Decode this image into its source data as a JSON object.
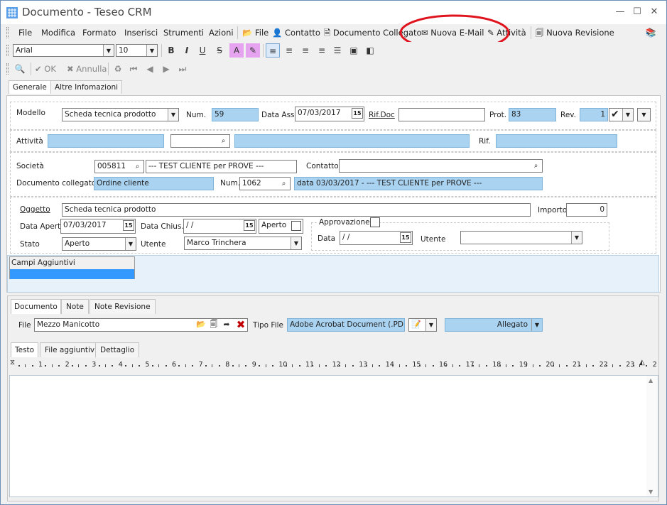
{
  "window": {
    "title": "Documento - Teseo CRM"
  },
  "menu": {
    "file": "File",
    "modifica": "Modifica",
    "formato": "Formato",
    "inserisci": "Inserisci",
    "strumenti": "Strumenti",
    "azioni": "Azioni"
  },
  "actions": {
    "file": "File",
    "contatto": "Contatto",
    "documento_collegato": "Documento Collegato",
    "nuova_email": "Nuova E-Mail",
    "attivita": "Attività",
    "nuova_revisione": "Nuova Revisione"
  },
  "format": {
    "font": "Arial",
    "size": "10"
  },
  "nav": {
    "ok": "OK",
    "annulla": "Annulla"
  },
  "tabs_main": [
    "Generale",
    "Altre Infomazioni"
  ],
  "modello": {
    "label": "Modello",
    "value": "Scheda tecnica prodotto",
    "num_label": "Num.",
    "num": "59",
    "data_ass_label": "Data Ass.",
    "data_ass": "07/03/2017",
    "rifdoc_label": "Rif.Doc",
    "rifdoc": "",
    "prot_label": "Prot.",
    "prot": "83",
    "rev_label": "Rev.",
    "rev": "1"
  },
  "attivita": {
    "label": "Attività",
    "rif_label": "Rif."
  },
  "societa": {
    "label": "Società",
    "code": "005811",
    "name": "--- TEST CLIENTE per PROVE ---",
    "contatto_label": "Contatto",
    "contatto": ""
  },
  "doc_collegato": {
    "label": "Documento collegato",
    "value": "Ordine cliente",
    "num_label": "Num.",
    "num": "1062",
    "desc": "data 03/03/2017 - --- TEST CLIENTE per PROVE ---"
  },
  "oggetto": {
    "label": "Oggetto",
    "value": "Scheda tecnica prodotto",
    "importo_label": "Importo",
    "importo": "0"
  },
  "date": {
    "apert_label": "Data Apert.",
    "apert": "07/03/2017",
    "chius_label": "Data Chius.",
    "chius": " / /",
    "aperto_label": "Aperto"
  },
  "stato": {
    "label": "Stato",
    "value": "Aperto",
    "utente_label": "Utente",
    "utente": "Marco Trinchera"
  },
  "approvazione": {
    "label": "Approvazione",
    "data_label": "Data",
    "data": " / /",
    "utente_label": "Utente",
    "utente": ""
  },
  "campi": {
    "header": "Campi Aggiuntivi"
  },
  "tabs_doc": [
    "Documento",
    "Note",
    "Note Revisione"
  ],
  "file": {
    "label": "File",
    "value": "Mezzo Manicotto",
    "tipo_label": "Tipo File",
    "tipo": "Adobe Acrobat Document (.PDF)",
    "allegato": "Allegato"
  },
  "tabs_text": [
    "Testo",
    "File aggiuntivi",
    "Dettaglio"
  ],
  "ruler": [
    "1",
    "2",
    "3",
    "4",
    "5",
    "6",
    "7",
    "8",
    "9",
    "10",
    "11",
    "12",
    "13",
    "14",
    "15",
    "16",
    "17",
    "18",
    "19",
    "20",
    "21",
    "22",
    "23",
    "2"
  ],
  "colors": {
    "accent": "#a9d3f1",
    "selection": "#3399ff",
    "highlight_circle": "#e0141e"
  }
}
